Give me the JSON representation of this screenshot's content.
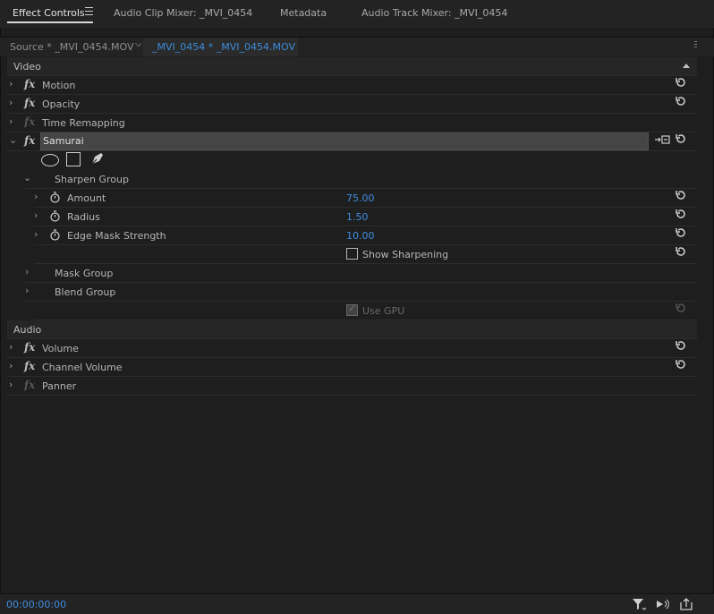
{
  "tabs": [
    {
      "label": "Effect Controls",
      "active": true
    },
    {
      "label": "Audio Clip Mixer: _MVI_0454",
      "active": false
    },
    {
      "label": "Metadata",
      "active": false
    },
    {
      "label": "Audio Track Mixer: _MVI_0454",
      "active": false
    }
  ],
  "source": {
    "left_label": "Source * _MVI_0454.MOV",
    "right_label": "_MVI_0454 * _MVI_0454.MOV"
  },
  "sections": {
    "video": "Video",
    "audio": "Audio"
  },
  "video_effects": {
    "motion": "Motion",
    "opacity": "Opacity",
    "time_remapping": "Time Remapping",
    "samurai": "Samurai"
  },
  "sharpen_group": {
    "label": "Sharpen Group",
    "amount": {
      "label": "Amount",
      "value": "75.00"
    },
    "radius": {
      "label": "Radius",
      "value": "1.50"
    },
    "edge_mask_strength": {
      "label": "Edge Mask Strength",
      "value": "10.00"
    },
    "show_sharpening": "Show Sharpening"
  },
  "groups": {
    "mask": "Mask Group",
    "blend": "Blend Group",
    "use_gpu": "Use GPU"
  },
  "audio_effects": {
    "volume": "Volume",
    "channel_volume": "Channel Volume",
    "panner": "Panner"
  },
  "footer": {
    "timecode": "00:00:00:00"
  },
  "icons": {
    "fx": "fx",
    "expand": "›",
    "collapse": "⌄"
  },
  "colors": {
    "accent_blue": "#3f8de0",
    "panel_bg": "#1e1e1e"
  }
}
